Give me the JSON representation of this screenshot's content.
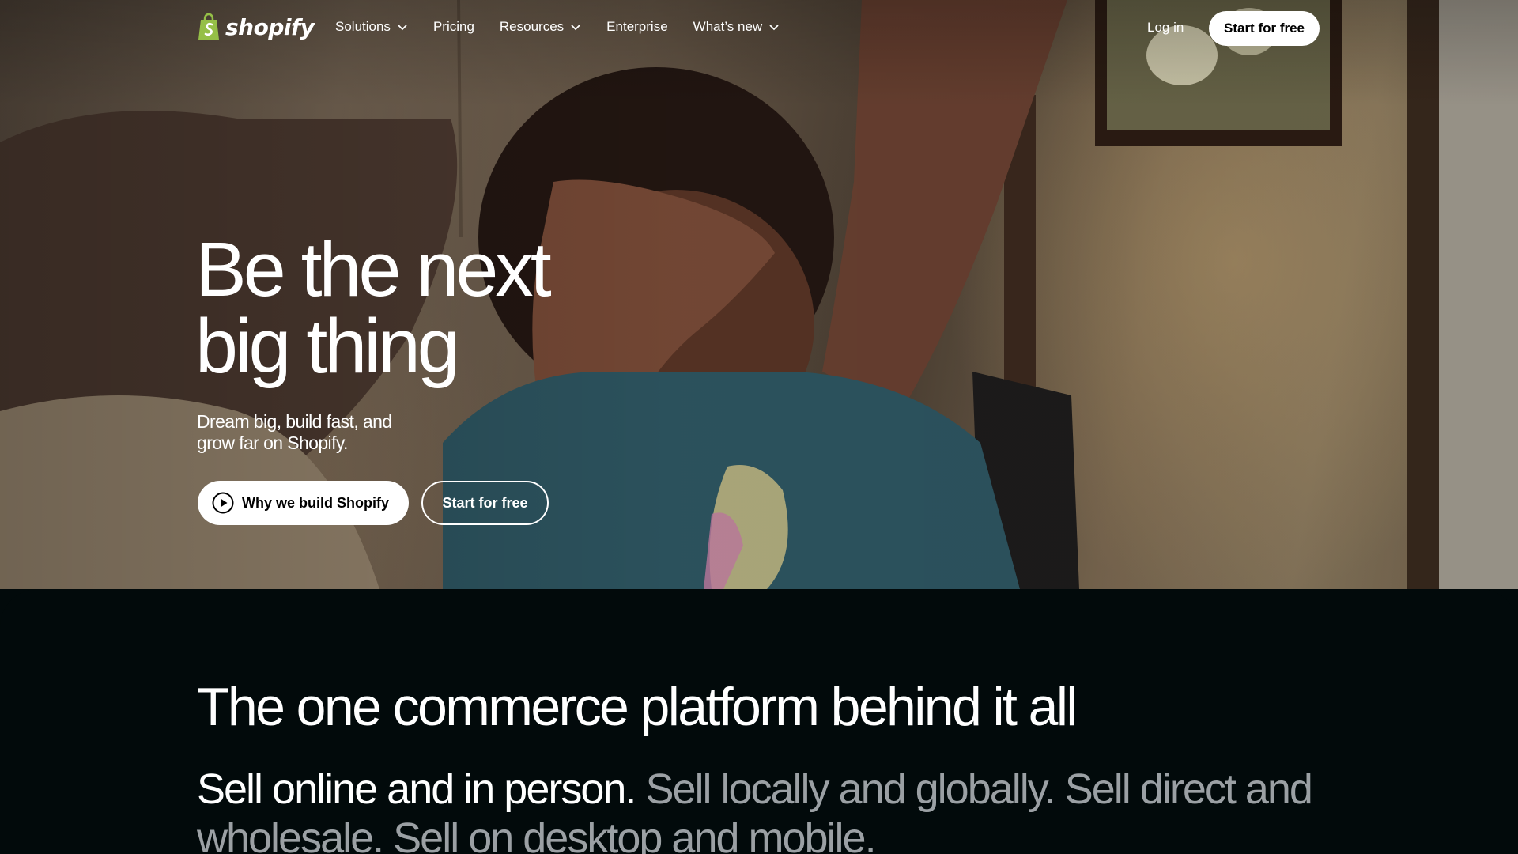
{
  "nav": {
    "logo_text": "shopify",
    "items": [
      {
        "label": "Solutions",
        "has_dropdown": true
      },
      {
        "label": "Pricing",
        "has_dropdown": false
      },
      {
        "label": "Resources",
        "has_dropdown": true
      },
      {
        "label": "Enterprise",
        "has_dropdown": false
      },
      {
        "label": "What’s new",
        "has_dropdown": true
      }
    ],
    "login": "Log in",
    "cta": "Start for free"
  },
  "hero": {
    "title_line1": "Be the next",
    "title_line2": "big thing",
    "subtitle_line1": "Dream big, build fast, and",
    "subtitle_line2": "grow far on Shopify.",
    "primary_button": "Why we build Shopify",
    "secondary_button": "Start for free"
  },
  "platform": {
    "title": "The one commerce platform behind it all",
    "sell_bright": "Sell online and in person.",
    "sell_dim": "Sell locally and globally. Sell direct and wholesale. Sell on desktop and mobile."
  },
  "colors": {
    "brand_green": "#95bf47",
    "dark_bg": "#020a0b",
    "dim_text": "#9ba0a4"
  },
  "icons": {
    "logo": "shopify-bag-icon",
    "dropdown": "chevron-down-icon",
    "play": "play-circle-icon"
  }
}
